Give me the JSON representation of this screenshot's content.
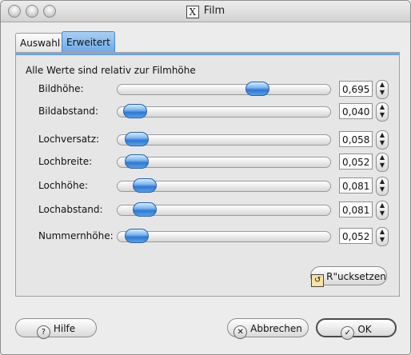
{
  "window": {
    "title": "Film"
  },
  "tabs": [
    {
      "label": "Auswahl"
    },
    {
      "label": "Erweitert"
    }
  ],
  "panel": {
    "hint": "Alle Werte sind relativ zur Filmhöhe",
    "rows": [
      {
        "label": "Bildhöhe:",
        "value": "0,695",
        "fraction": 0.68
      },
      {
        "label": "Bildabstand:",
        "value": "0,040",
        "fraction": 0.03
      },
      {
        "label": "Lochversatz:",
        "value": "0,058",
        "fraction": 0.04
      },
      {
        "label": "Lochbreite:",
        "value": "0,052",
        "fraction": 0.04
      },
      {
        "label": "Lochhöhe:",
        "value": "0,081",
        "fraction": 0.08
      },
      {
        "label": "Lochabstand:",
        "value": "0,081",
        "fraction": 0.08
      },
      {
        "label": "Nummernhöhe:",
        "value": "0,052",
        "fraction": 0.04
      }
    ],
    "reset_label": "R\"ucksetzen"
  },
  "buttons": {
    "help": "Hilfe",
    "cancel": "Abbrechen",
    "ok": "OK"
  },
  "icons": {
    "help": "help-icon",
    "cancel": "cancel-icon",
    "ok": "checkmark-icon",
    "reset": "reset-icon"
  }
}
